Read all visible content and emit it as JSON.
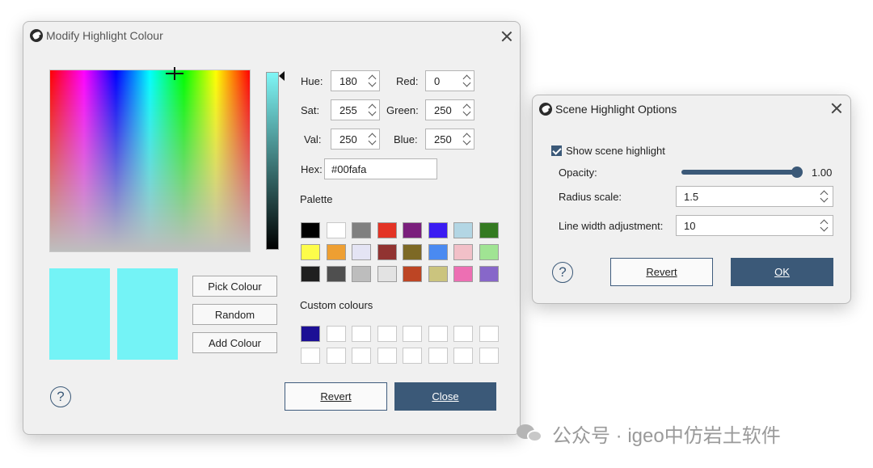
{
  "colour_dialog": {
    "title": "Modify Highlight Colour",
    "hue_label": "Hue:",
    "hue_value": "180",
    "sat_label": "Sat:",
    "sat_value": "255",
    "val_label": "Val:",
    "val_value": "250",
    "red_label": "Red:",
    "red_value": "0",
    "green_label": "Green:",
    "green_value": "250",
    "blue_label": "Blue:",
    "blue_value": "250",
    "hex_label": "Hex:",
    "hex_value": "#00fafa",
    "palette_label": "Palette",
    "custom_label": "Custom colours",
    "pick_label": "Pick Colour",
    "random_label": "Random",
    "add_label": "Add Colour",
    "revert_label": "Revert",
    "close_label": "Close",
    "help_glyph": "?",
    "current_colour": "#74f3f6",
    "palette": [
      "#000000",
      "#ffffff",
      "#808080",
      "#e33325",
      "#7a1f7c",
      "#3a1cf2",
      "#b3d6e4",
      "#347a21",
      "#fdfc4a",
      "#ee9f32",
      "#e4e4f4",
      "#913331",
      "#7d6925",
      "#4a8af1",
      "#f2c0c8",
      "#a0e493",
      "#1f1f1f",
      "#4f4f4f",
      "#bdbdbd",
      "#e3e3e3",
      "#bd4524",
      "#cbc47e",
      "#ed6fb3",
      "#8767c9"
    ],
    "custom_colours": [
      "#1c0f95",
      "#ffffff",
      "#ffffff",
      "#ffffff",
      "#ffffff",
      "#ffffff",
      "#ffffff",
      "#ffffff",
      "#ffffff",
      "#ffffff",
      "#ffffff",
      "#ffffff",
      "#ffffff",
      "#ffffff",
      "#ffffff",
      "#ffffff"
    ]
  },
  "scene_dialog": {
    "title": "Scene Highlight Options",
    "show_label": "Show scene highlight",
    "show_checked": true,
    "opacity_label": "Opacity:",
    "opacity_value": "1.00",
    "radius_label": "Radius scale:",
    "radius_value": "1.5",
    "line_label": "Line width adjustment:",
    "line_value": "10",
    "revert_label": "Revert",
    "ok_label": "OK",
    "help_glyph": "?"
  },
  "watermark": {
    "text": "公众号 · igeo中仿岩土软件"
  }
}
